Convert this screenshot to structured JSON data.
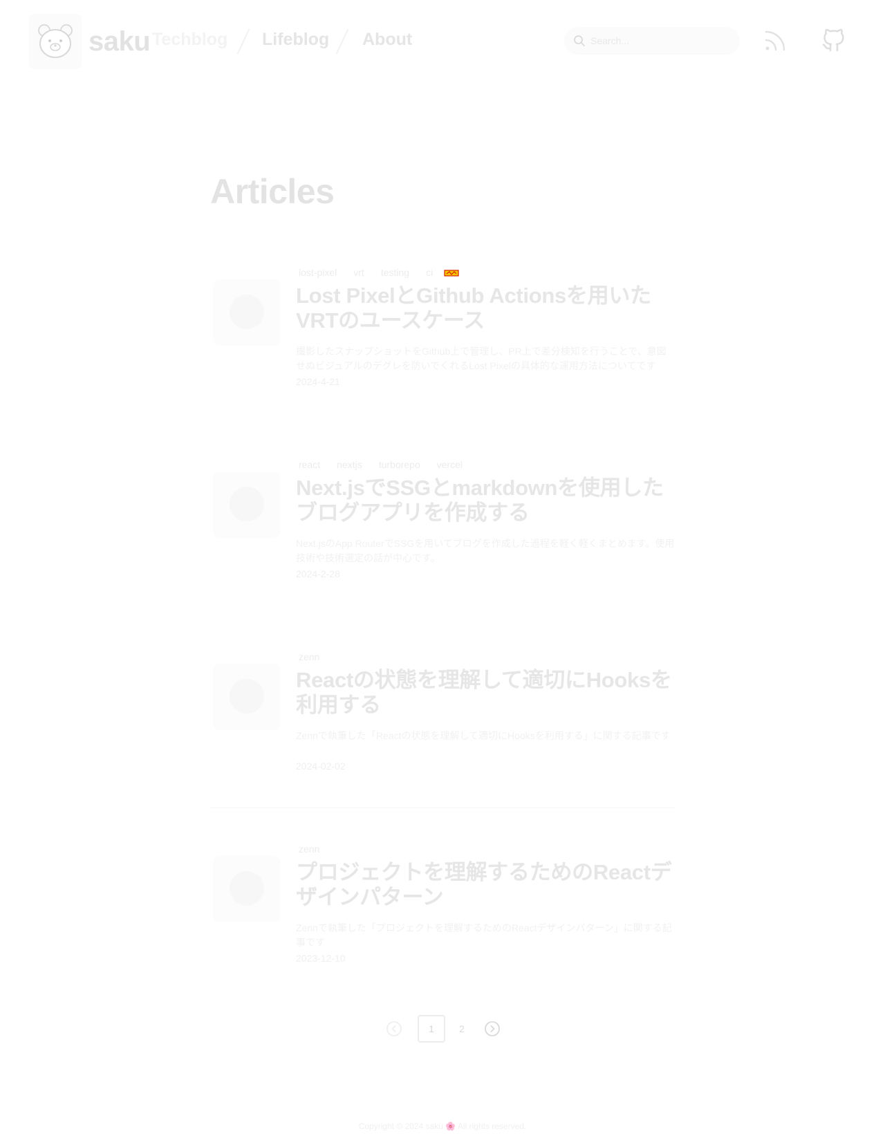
{
  "header": {
    "brand": "saku",
    "nav": [
      {
        "label": "Techblog"
      },
      {
        "label": "Lifeblog"
      },
      {
        "label": "About"
      }
    ],
    "search_placeholder": "Search..."
  },
  "main": {
    "title": "Articles",
    "articles": [
      {
        "tags": [
          "lost-pixel",
          "vrt",
          "testing",
          "ci"
        ],
        "title": "Lost PixelとGithub Actionsを用いたVRTのユースケース",
        "description": "撮影したスナップショットをGithub上で管理し、PR上で差分検知を行うことで、意図せぬビジュアルのデグレを防いでくれるLost Pixelの具体的な運用方法についてです",
        "date": "2024-4-21"
      },
      {
        "tags": [
          "react",
          "nextjs",
          "turborepo",
          "vercel"
        ],
        "title": "Next.jsでSSGとmarkdownを使用したブログアプリを作成する",
        "description": "Next.jsのApp RouterでSSGを用いてブログを作成した過程を軽く軽くまとめます。使用技術や技術選定の話が中心です。",
        "date": "2024-2-28"
      },
      {
        "tags": [
          "zenn"
        ],
        "title": "Reactの状態を理解して適切にHooksを利用する",
        "description": "Zennで執筆した「Reactの状態を理解して適切にHooksを利用する」に関する記事です",
        "date": "2024-02-02"
      },
      {
        "tags": [
          "zenn"
        ],
        "title": "プロジェクトを理解するためのReactデザインパターン",
        "description": "Zennで執筆した「プロジェクトを理解するためのReactデザインパターン」に関する記事です",
        "date": "2023-12-10"
      }
    ]
  },
  "pagination": {
    "pages": [
      "1",
      "2"
    ],
    "current": "1"
  },
  "footer": {
    "text": "Copyright © 2024 saku 🌸 All rights reserved."
  },
  "icons": {
    "search": "search-icon",
    "rss": "rss-icon",
    "github": "github-icon",
    "prev": "chevron-left-icon",
    "next": "chevron-right-icon"
  }
}
